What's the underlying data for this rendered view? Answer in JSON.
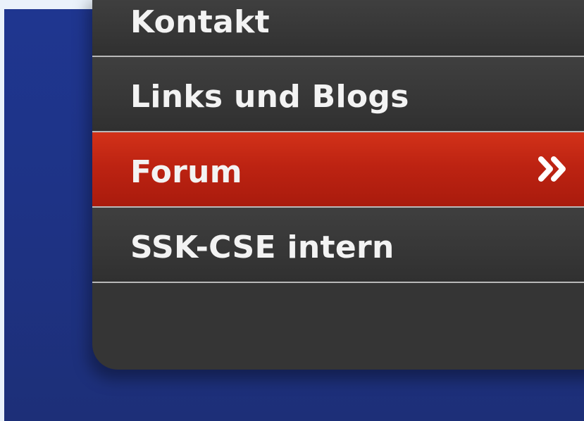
{
  "menu": {
    "items": [
      {
        "label": "Kontakt"
      },
      {
        "label": "Links und Blogs"
      },
      {
        "label": "Forum",
        "active": true,
        "icon": "double-chevron-right-icon"
      },
      {
        "label": "SSK-CSE intern"
      }
    ]
  },
  "colors": {
    "outer_background": "#eaf2fb",
    "page_background": "#1f3690",
    "menu_background": "#353535",
    "active_item": "#c0281a",
    "divider": "#b9b9b9",
    "text": "#f3f3f3"
  }
}
